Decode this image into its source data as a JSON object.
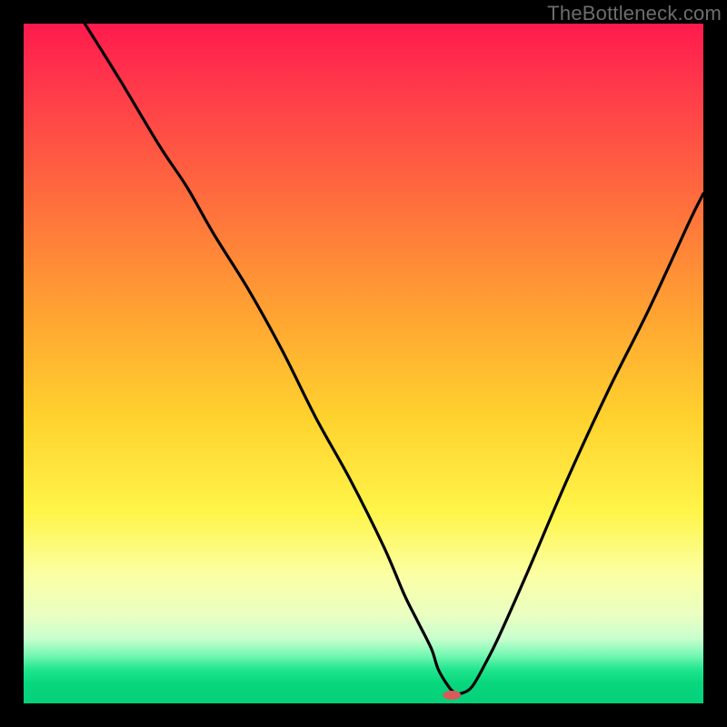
{
  "watermark": "TheBottleneck.com",
  "chart_data": {
    "type": "line",
    "title": "",
    "xlabel": "",
    "ylabel": "",
    "xrange": [
      0,
      100
    ],
    "yrange": [
      0,
      100
    ],
    "grid": false,
    "legend": false,
    "series": [
      {
        "name": "bottleneck-curve",
        "color": "#000000",
        "x": [
          9,
          14,
          20,
          24,
          28,
          33,
          38,
          43,
          48,
          53,
          56,
          58,
          60,
          61,
          62.5,
          63.5,
          64.5,
          66,
          68,
          70,
          74,
          80,
          86,
          92,
          98,
          100
        ],
        "y": [
          100,
          92,
          82,
          76,
          69,
          61,
          52,
          42,
          33,
          23,
          16,
          12,
          8,
          5,
          2.5,
          1.5,
          1.5,
          2.5,
          6,
          10,
          19,
          33,
          46,
          58,
          71,
          75
        ]
      }
    ],
    "markers": [
      {
        "name": "highlight-point",
        "x": 63,
        "y": 1.2,
        "color": "#d85a5a",
        "rx": 10,
        "ry": 5
      }
    ],
    "background_gradient": {
      "direction": "vertical",
      "stops": [
        {
          "pos": 0.0,
          "color": "#ff1a4d"
        },
        {
          "pos": 0.1,
          "color": "#ff3b4a"
        },
        {
          "pos": 0.25,
          "color": "#ff6a3e"
        },
        {
          "pos": 0.42,
          "color": "#ffa132"
        },
        {
          "pos": 0.58,
          "color": "#ffd22e"
        },
        {
          "pos": 0.72,
          "color": "#fff54a"
        },
        {
          "pos": 0.81,
          "color": "#fbffa3"
        },
        {
          "pos": 0.87,
          "color": "#eaffc2"
        },
        {
          "pos": 0.905,
          "color": "#c8ffce"
        },
        {
          "pos": 0.93,
          "color": "#72f7b2"
        },
        {
          "pos": 0.95,
          "color": "#21e68e"
        },
        {
          "pos": 0.97,
          "color": "#07d77e"
        },
        {
          "pos": 1.0,
          "color": "#06d07a"
        }
      ]
    }
  }
}
